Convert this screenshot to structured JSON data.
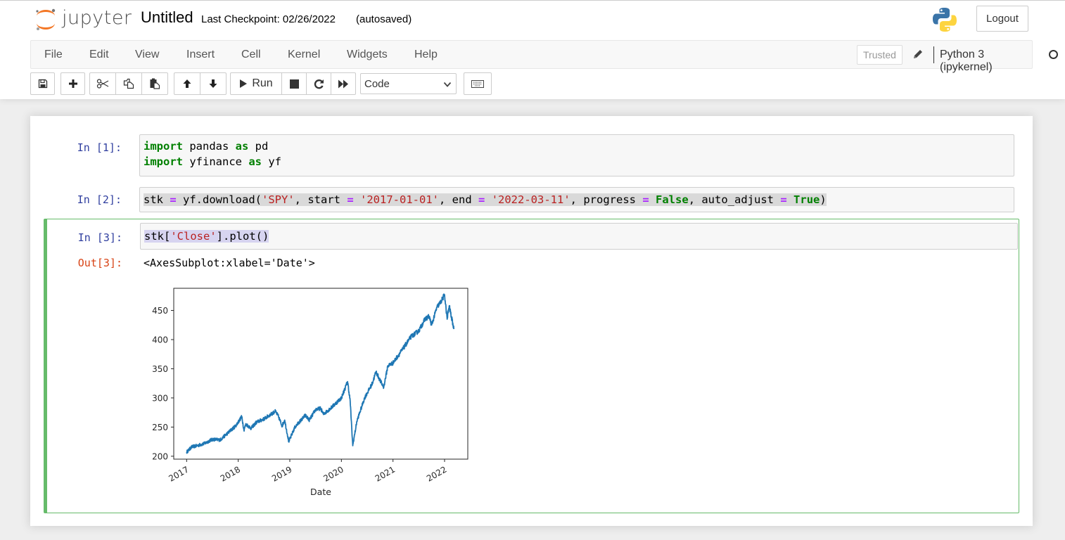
{
  "header": {
    "logo_text": "jupyter",
    "notebook_name": "Untitled",
    "checkpoint": "Last Checkpoint: 02/26/2022",
    "autosave": "(autosaved)",
    "logout_label": "Logout",
    "kernel_logo_icon": "python-logo-icon"
  },
  "menubar": {
    "items": [
      "File",
      "Edit",
      "View",
      "Insert",
      "Cell",
      "Kernel",
      "Widgets",
      "Help"
    ],
    "trusted_label": "Trusted",
    "kernel_name": "Python 3 (ipykernel)",
    "kernel_status": "idle"
  },
  "toolbar": {
    "buttons": [
      {
        "name": "save",
        "icon": "floppy-disk-icon"
      },
      {
        "name": "insert-cell-below",
        "icon": "plus-icon"
      },
      {
        "name": "cut",
        "icon": "scissors-icon"
      },
      {
        "name": "copy",
        "icon": "copy-icon"
      },
      {
        "name": "paste",
        "icon": "paste-icon"
      },
      {
        "name": "move-up",
        "icon": "arrow-up-icon"
      },
      {
        "name": "move-down",
        "icon": "arrow-down-icon"
      },
      {
        "name": "run",
        "icon": "play-icon"
      },
      {
        "name": "interrupt",
        "icon": "stop-icon"
      },
      {
        "name": "restart",
        "icon": "refresh-icon"
      },
      {
        "name": "restart-run-all",
        "icon": "fast-forward-icon"
      },
      {
        "name": "command-palette",
        "icon": "keyboard-icon"
      }
    ],
    "run_label": "Run",
    "cell_type": "Code"
  },
  "cells": [
    {
      "prompt": "In [1]:",
      "lines": [
        "import pandas as pd",
        "import yfinance as yf"
      ]
    },
    {
      "prompt": "In [2]:",
      "lines": [
        "stk = yf.download('SPY', start = '2017-01-01', end = '2022-03-11', progress = False, auto_adjust = True)"
      ]
    },
    {
      "prompt": "In [3]:",
      "lines": [
        "stk['Close'].plot()"
      ],
      "out_prompt": "Out[3]:",
      "output_text": "<AxesSubplot:xlabel='Date'>"
    }
  ],
  "chart_data": {
    "type": "line",
    "title": "",
    "xlabel": "Date",
    "ylabel": "",
    "xlim": [
      2016.75,
      2022.45
    ],
    "ylim": [
      195,
      488
    ],
    "grid": false,
    "legend": "none",
    "x_ticks": [
      2017,
      2018,
      2019,
      2020,
      2021,
      2022
    ],
    "x_tick_labels": [
      "2017",
      "2018",
      "2019",
      "2020",
      "2021",
      "2022"
    ],
    "y_ticks": [
      200,
      250,
      300,
      350,
      400,
      450
    ],
    "y_tick_labels": [
      "200",
      "250",
      "300",
      "350",
      "400",
      "450"
    ],
    "series": [
      {
        "name": "Close",
        "color": "#1f77b4",
        "x": [
          2017.0,
          2017.1,
          2017.2,
          2017.35,
          2017.5,
          2017.65,
          2017.8,
          2017.95,
          2018.07,
          2018.11,
          2018.15,
          2018.25,
          2018.35,
          2018.5,
          2018.72,
          2018.78,
          2018.85,
          2018.9,
          2018.98,
          2019.1,
          2019.3,
          2019.38,
          2019.5,
          2019.6,
          2019.65,
          2019.8,
          2020.0,
          2020.12,
          2020.17,
          2020.22,
          2020.3,
          2020.45,
          2020.6,
          2020.67,
          2020.75,
          2020.82,
          2020.9,
          2021.0,
          2021.2,
          2021.35,
          2021.5,
          2021.62,
          2021.7,
          2021.75,
          2021.85,
          2021.93,
          2022.0,
          2022.05,
          2022.09,
          2022.13,
          2022.18
        ],
        "y": [
          207,
          216,
          218,
          222,
          229,
          228,
          240,
          252,
          268,
          245,
          255,
          248,
          258,
          264,
          277,
          268,
          252,
          262,
          225,
          250,
          270,
          262,
          280,
          282,
          272,
          283,
          300,
          328,
          295,
          218,
          260,
          300,
          325,
          345,
          330,
          318,
          355,
          360,
          385,
          405,
          415,
          435,
          440,
          425,
          455,
          465,
          477,
          435,
          458,
          440,
          418
        ]
      }
    ]
  }
}
